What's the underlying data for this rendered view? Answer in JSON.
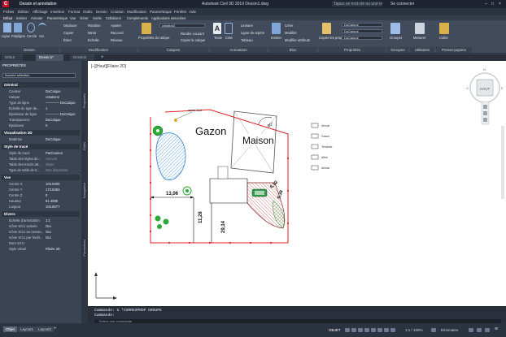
{
  "titlebar": {
    "app_title": "Autodesk Civil 3D 2019   Dessin1.dwg",
    "workspace": "Dessin et annotation",
    "search": "Tapez un mot-clé ou une expression",
    "user": "Se connecter"
  },
  "menu": [
    "Fichier",
    "Édition",
    "Affichage",
    "Insertion",
    "Format",
    "Outils",
    "Dessin",
    "Cotation",
    "Modification",
    "Paramétrique",
    "Fenêtre",
    "Aide"
  ],
  "ribbon_tabs": [
    "Début",
    "Insérer",
    "Annoter",
    "Paramétrique",
    "Vue",
    "Gérer",
    "Sortie",
    "Collaborer",
    "Compléments",
    "Applications associées"
  ],
  "ribbon": {
    "draw": {
      "title": "Dessin",
      "line": "Ligne",
      "polyline": "Polyligne",
      "circle": "Cercle",
      "arc": "Arc"
    },
    "modify": {
      "title": "Modification",
      "move": "Déplacer",
      "rotate": "Rotation",
      "trim": "Ajuster",
      "copy": "Copier",
      "mirror": "Miroir",
      "fillet": "Raccord",
      "stretch": "Étirer",
      "scale": "Échelle",
      "array": "Réseau"
    },
    "layers": {
      "title": "Calques",
      "props": "Propriétés du calque",
      "layer": "cotation2",
      "make_current": "Rendre courant",
      "match": "Copier le calque"
    },
    "annotation": {
      "title": "Annotation",
      "text": "Texte",
      "dim": "Cote",
      "leader": "Ligne de repère",
      "table": "Tableau",
      "linear": "Linéaire"
    },
    "block": {
      "title": "Bloc",
      "insert": "Insérer",
      "create": "Créer",
      "edit": "Modifier",
      "attr": "Modifier attributs"
    },
    "properties": {
      "title": "Propriétés",
      "match": "Copier les propriétés",
      "bylayer": "DuCalque"
    },
    "groups": {
      "title": "Groupes",
      "group": "Grouper"
    },
    "utilities": {
      "title": "Utilitaires",
      "measure": "Mesurer"
    },
    "clipboard": {
      "title": "Presse-papiers",
      "paste": "Coller"
    }
  },
  "doc_tabs": [
    "Début",
    "Dessin1*",
    "Dessin2"
  ],
  "palette": {
    "title": "PROPRIÉTÉS",
    "selection": "Aucune sélection",
    "sections": [
      {
        "name": "Général",
        "rows": [
          [
            "Couleur",
            "DuCalque"
          ],
          [
            "Calque",
            "cotation2"
          ],
          [
            "Type de ligne",
            "———— DuCalque"
          ],
          [
            "Échelle du type de...",
            "1"
          ],
          [
            "Épaisseur de ligne",
            "———— DuCalque"
          ],
          [
            "Transparence",
            "DuCalque"
          ],
          [
            "Épaisseur",
            "0"
          ]
        ]
      },
      {
        "name": "Visualisation 3D",
        "rows": [
          [
            "Matériau",
            "DuCalque"
          ]
        ]
      },
      {
        "name": "Style de tracé",
        "rows": [
          [
            "Style de tracé",
            "ParCouleur"
          ],
          [
            "Table des styles de...",
            "Aucune"
          ],
          [
            "Table des tracés att...",
            "Objet"
          ],
          [
            "Type de table de tr...",
            "Non disponible"
          ]
        ]
      },
      {
        "name": "Vue",
        "rows": [
          [
            "Centre X",
            "104.9400"
          ],
          [
            "Centre Y",
            "173.5483"
          ],
          [
            "Centre Z",
            "0"
          ],
          [
            "Hauteur",
            "61.4595"
          ],
          [
            "Largeur",
            "104.8077"
          ]
        ]
      },
      {
        "name": "Divers",
        "rows": [
          [
            "Échelle d'annotation",
            "1:1"
          ],
          [
            "Icône SCU activée",
            "Oui"
          ],
          [
            "Icône SCU au niveau...",
            "Oui"
          ],
          [
            "Icône SCU par fenêt...",
            "Oui"
          ],
          [
            "Nom SCU",
            ""
          ],
          [
            "Style visuel",
            "Filaire 2D"
          ]
        ]
      }
    ],
    "side_tabs": [
      "Propriétés",
      "Outils",
      "Navigateur",
      "Paramètres"
    ]
  },
  "viewport": {
    "label": "[–][Haut][Filaire 2D]",
    "viewcube": "HAUT",
    "compass": [
      "N",
      "S",
      "E",
      "O"
    ]
  },
  "drawing": {
    "gazon": "Gazon",
    "maison": "Maison",
    "arbre": "arbre fruit",
    "dims": [
      "13,06",
      "11,28",
      "29,14",
      "6,92",
      "6,38",
      "90°"
    ],
    "legend": [
      "Arbust",
      "Gazon",
      "Terrasse",
      "Allée",
      "Arbust"
    ]
  },
  "command": {
    "line1": "Commande: U  *CORRESPROP GROUPE",
    "line2": "Commande:",
    "input_placeholder": "Entrez une commande"
  },
  "layout_tabs": [
    "Objet",
    "Layout1",
    "Layout2"
  ],
  "status": {
    "mode": "OBJET",
    "scale": "1:1 / 100%",
    "dec": "Décimales"
  }
}
